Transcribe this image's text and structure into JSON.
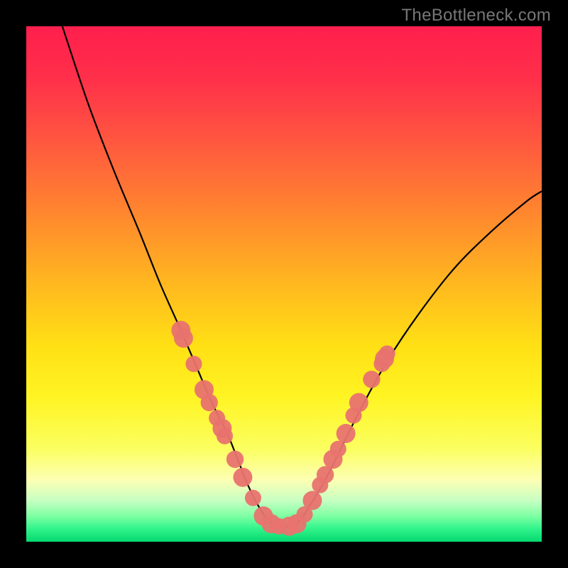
{
  "watermark": "TheBottleneck.com",
  "gradient": {
    "stops": [
      {
        "offset": 0.0,
        "color": "#ff1f4d"
      },
      {
        "offset": 0.1,
        "color": "#ff2f4a"
      },
      {
        "offset": 0.22,
        "color": "#ff5640"
      },
      {
        "offset": 0.35,
        "color": "#ff8230"
      },
      {
        "offset": 0.5,
        "color": "#ffb81f"
      },
      {
        "offset": 0.62,
        "color": "#ffe015"
      },
      {
        "offset": 0.72,
        "color": "#fff423"
      },
      {
        "offset": 0.82,
        "color": "#fbff60"
      },
      {
        "offset": 0.88,
        "color": "#fdffb3"
      },
      {
        "offset": 0.92,
        "color": "#c7ffc2"
      },
      {
        "offset": 0.95,
        "color": "#7effa3"
      },
      {
        "offset": 0.975,
        "color": "#30f48b"
      },
      {
        "offset": 1.0,
        "color": "#05d86e"
      }
    ]
  },
  "chart_data": {
    "type": "line",
    "title": "",
    "xlabel": "",
    "ylabel": "",
    "xlim": [
      0,
      100
    ],
    "ylim": [
      0,
      100
    ],
    "series": [
      {
        "name": "bottleneck-curve",
        "x": [
          7,
          12,
          17,
          22,
          26,
          30,
          33,
          36,
          39,
          41,
          43,
          45,
          47,
          49,
          51,
          53,
          55,
          58,
          61,
          65,
          70,
          76,
          83,
          90,
          97,
          100
        ],
        "values": [
          100,
          85,
          72,
          60,
          50,
          41,
          34,
          27,
          21,
          16,
          11,
          7,
          4,
          3,
          3,
          4,
          7,
          12,
          18,
          26,
          35,
          44,
          53,
          60,
          66,
          68
        ]
      }
    ],
    "markers": {
      "name": "highlight-points",
      "color": "#e8736f",
      "points": [
        {
          "x": 30.0,
          "y": 41.0,
          "r": 1.3
        },
        {
          "x": 30.5,
          "y": 39.5,
          "r": 1.3
        },
        {
          "x": 32.5,
          "y": 34.5,
          "r": 1.0
        },
        {
          "x": 34.5,
          "y": 29.5,
          "r": 1.3
        },
        {
          "x": 35.5,
          "y": 27.0,
          "r": 1.1
        },
        {
          "x": 37.0,
          "y": 24.0,
          "r": 1.0
        },
        {
          "x": 38.0,
          "y": 22.0,
          "r": 1.3
        },
        {
          "x": 38.5,
          "y": 20.5,
          "r": 1.0
        },
        {
          "x": 40.5,
          "y": 16.0,
          "r": 1.1
        },
        {
          "x": 42.0,
          "y": 12.5,
          "r": 1.3
        },
        {
          "x": 44.0,
          "y": 8.5,
          "r": 1.0
        },
        {
          "x": 46.0,
          "y": 5.0,
          "r": 1.3
        },
        {
          "x": 47.5,
          "y": 3.5,
          "r": 1.3
        },
        {
          "x": 49.0,
          "y": 3.0,
          "r": 1.0
        },
        {
          "x": 51.0,
          "y": 3.0,
          "r": 1.3
        },
        {
          "x": 52.5,
          "y": 3.5,
          "r": 1.3
        },
        {
          "x": 54.0,
          "y": 5.3,
          "r": 1.0
        },
        {
          "x": 55.5,
          "y": 8.0,
          "r": 1.3
        },
        {
          "x": 57.0,
          "y": 11.0,
          "r": 1.0
        },
        {
          "x": 58.0,
          "y": 13.0,
          "r": 1.1
        },
        {
          "x": 59.5,
          "y": 16.0,
          "r": 1.3
        },
        {
          "x": 60.5,
          "y": 18.0,
          "r": 1.0
        },
        {
          "x": 62.0,
          "y": 21.0,
          "r": 1.3
        },
        {
          "x": 63.5,
          "y": 24.5,
          "r": 1.0
        },
        {
          "x": 64.5,
          "y": 27.0,
          "r": 1.3
        },
        {
          "x": 67.0,
          "y": 31.5,
          "r": 1.1
        },
        {
          "x": 69.0,
          "y": 34.5,
          "r": 1.0
        },
        {
          "x": 69.5,
          "y": 35.5,
          "r": 1.3
        },
        {
          "x": 70.0,
          "y": 36.5,
          "r": 1.0
        }
      ]
    }
  }
}
